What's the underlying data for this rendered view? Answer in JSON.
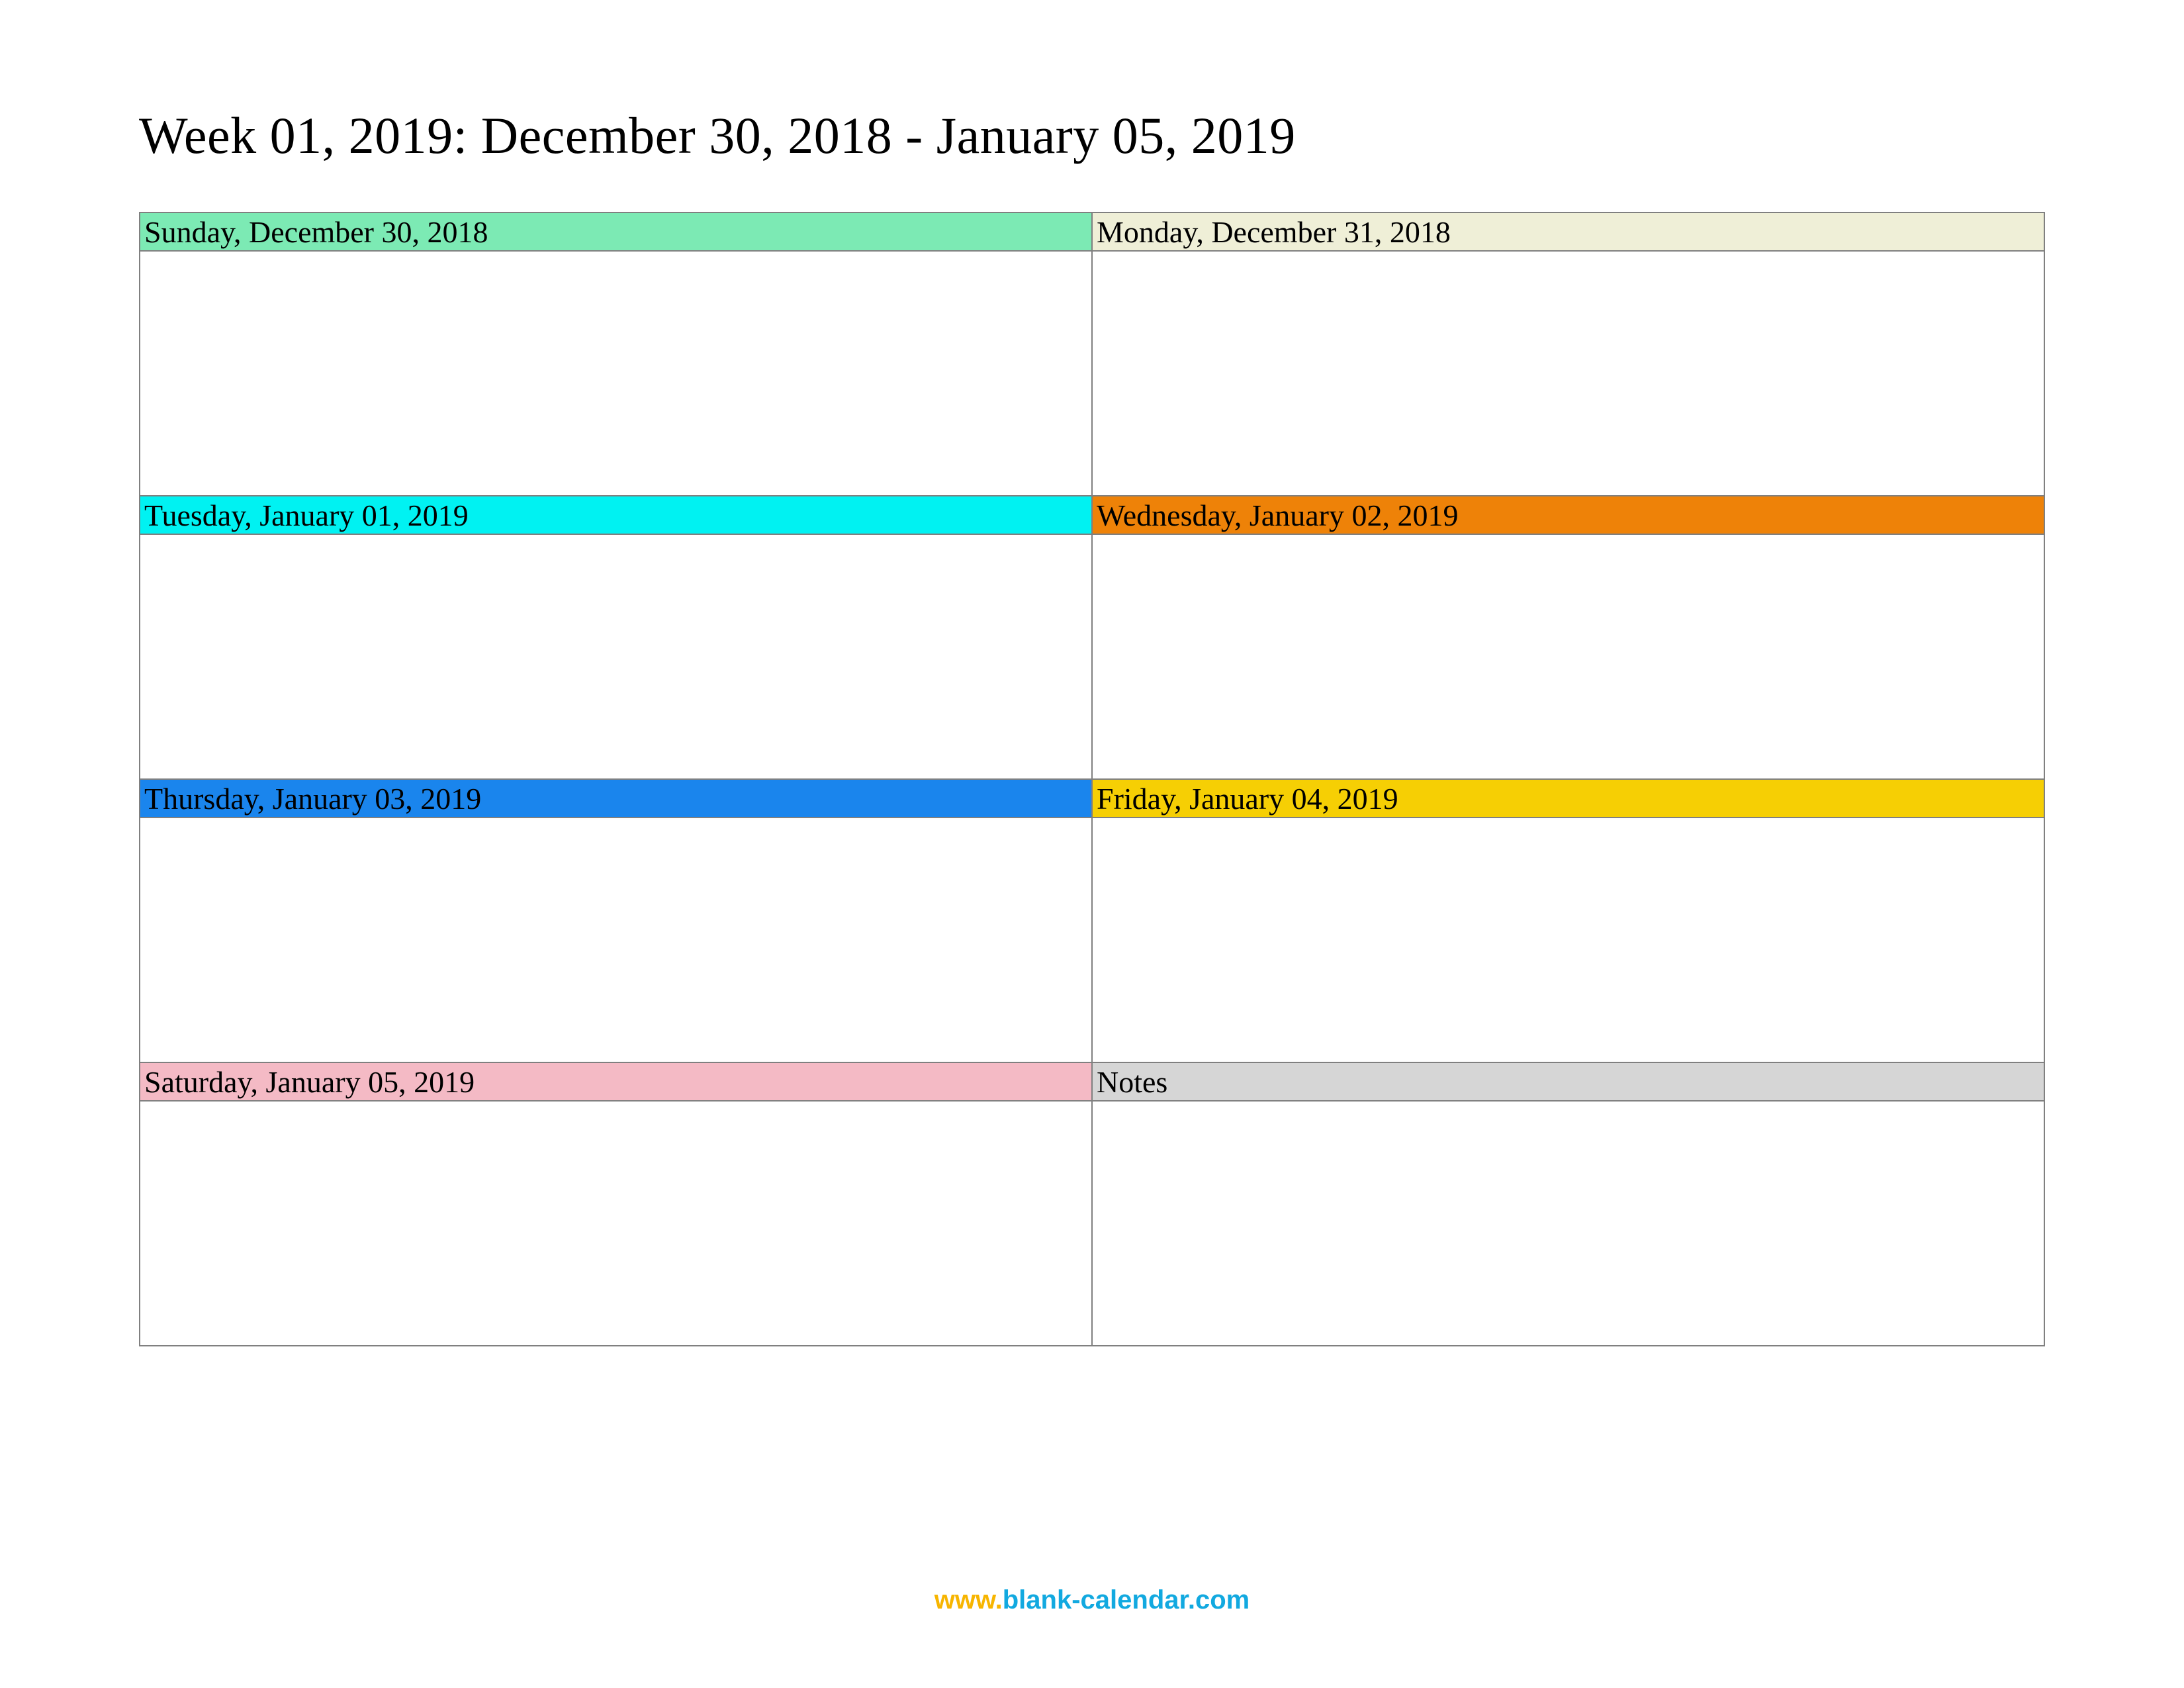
{
  "title": "Week 01, 2019: December 30, 2018 - January 05, 2019",
  "cells": [
    {
      "label": "Sunday, December 30, 2018",
      "color": "#7ceab4"
    },
    {
      "label": "Monday, December 31, 2018",
      "color": "#efefd7"
    },
    {
      "label": "Tuesday, January 01, 2019",
      "color": "#00f2f2"
    },
    {
      "label": "Wednesday, January 02, 2019",
      "color": "#ee8208"
    },
    {
      "label": "Thursday, January 03, 2019",
      "color": "#1a85ed"
    },
    {
      "label": "Friday, January 04, 2019",
      "color": "#f6cf04"
    },
    {
      "label": "Saturday, January 05, 2019",
      "color": "#f4bac5"
    },
    {
      "label": "Notes",
      "color": "#d6d6d6"
    }
  ],
  "footer": {
    "part1": "www.",
    "part2": "blank-calendar.com"
  }
}
